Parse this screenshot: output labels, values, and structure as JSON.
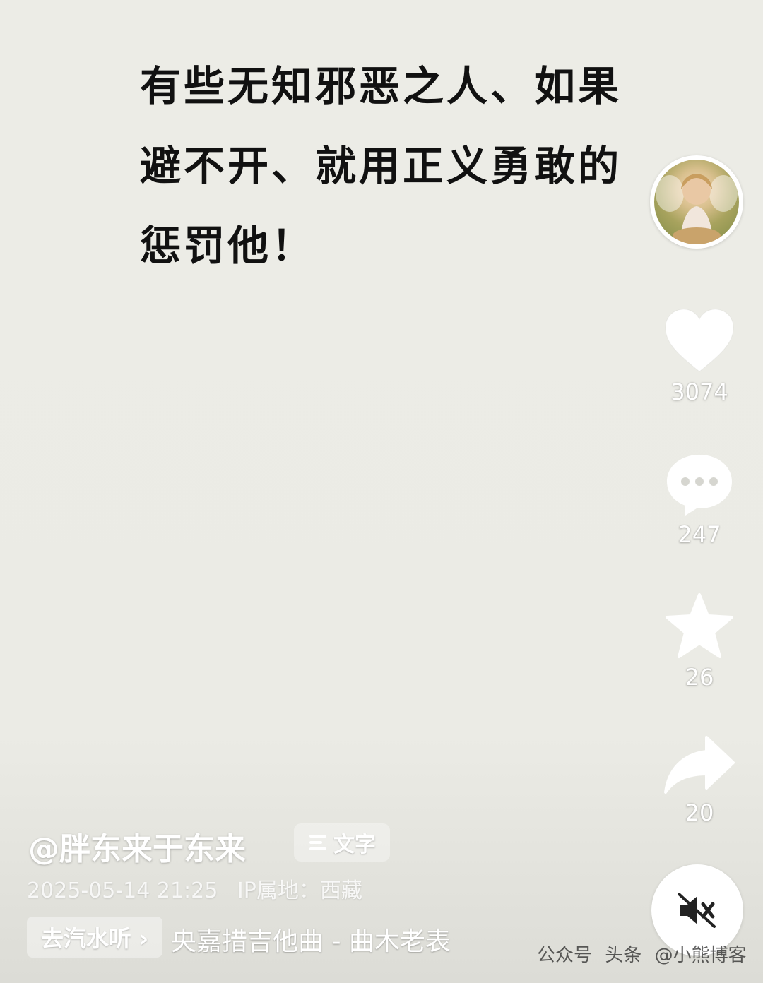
{
  "post": {
    "lines": [
      "有些无知邪恶之人、如果",
      "避不开、就用正义勇敢的",
      "惩罚他！"
    ]
  },
  "actions": {
    "like_count": "3074",
    "comment_count": "247",
    "favorite_count": "26",
    "share_count": "20"
  },
  "author": {
    "username": "@胖东来于东来",
    "text_badge": "文字"
  },
  "meta": {
    "date": "2025-05-14 21:25",
    "ip_location": "IP属地：西藏"
  },
  "music": {
    "badge": "去汽水听 ›",
    "title": "央嘉措吉他曲 - 曲木老表"
  },
  "watermark": {
    "source1": "公众号",
    "source2": "头条",
    "source3": "@小熊博客"
  }
}
